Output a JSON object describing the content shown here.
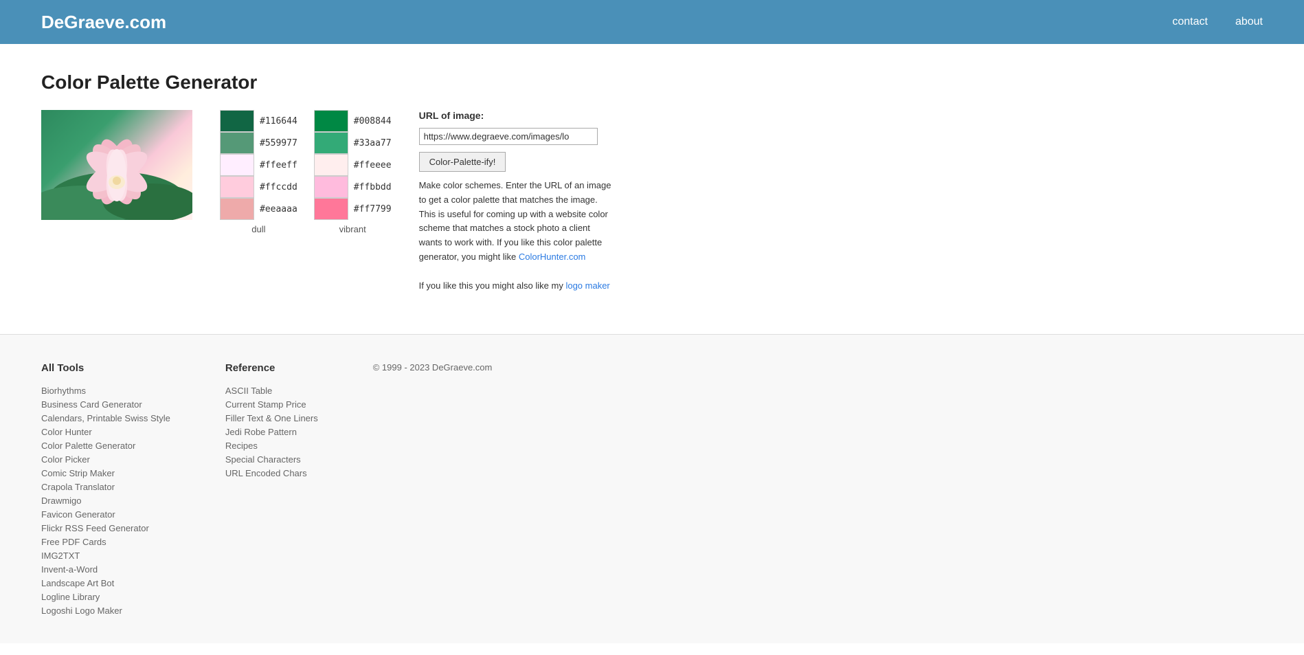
{
  "header": {
    "logo": "DeGraeve.com",
    "nav": [
      {
        "label": "contact",
        "href": "#"
      },
      {
        "label": "about",
        "href": "#"
      }
    ]
  },
  "main": {
    "page_title": "Color Palette Generator",
    "url_label": "URL of image:",
    "url_value": "https://www.degraeve.com/images/lo",
    "generate_button_label": "Color-Palette-ify!",
    "description_text1": "Make color schemes. Enter the URL of an image to get a color palette that matches the image. This is useful for coming up with a website color scheme that matches a stock photo a client wants to work with. If you like this color palette generator, you might like ",
    "colorhunter_link": "ColorHunter.com",
    "description_text2": "If you like this you might also like my ",
    "logomaker_link": "logo maker",
    "dull_label": "dull",
    "vibrant_label": "vibrant",
    "swatches_dull": [
      {
        "hex": "#116644",
        "color": "#116644"
      },
      {
        "hex": "#559977",
        "color": "#559977"
      },
      {
        "hex": "#ffeeff",
        "color": "#ffeeff"
      },
      {
        "hex": "#ffccdd",
        "color": "#ffccdd"
      },
      {
        "hex": "#eeaaaa",
        "color": "#eeaaaa"
      }
    ],
    "swatches_vibrant": [
      {
        "hex": "#008844",
        "color": "#008844"
      },
      {
        "hex": "#33aa77",
        "color": "#33aa77"
      },
      {
        "hex": "#ffeeee",
        "color": "#ffeeee"
      },
      {
        "hex": "#ffbbdd",
        "color": "#ffbbdd"
      },
      {
        "hex": "#ff7799",
        "color": "#ff7799"
      }
    ]
  },
  "footer": {
    "all_tools_label": "All Tools",
    "reference_label": "Reference",
    "copyright": "© 1999 - 2023 DeGraeve.com",
    "all_tools": [
      "Biorhythms",
      "Business Card Generator",
      "Calendars, Printable Swiss Style",
      "Color Hunter",
      "Color Palette Generator",
      "Color Picker",
      "Comic Strip Maker",
      "Crapola Translator",
      "Drawmigo",
      "Favicon Generator",
      "Flickr RSS Feed Generator",
      "Free PDF Cards",
      "IMG2TXT",
      "Invent-a-Word",
      "Landscape Art Bot",
      "Logline Library",
      "Logoshi Logo Maker"
    ],
    "reference": [
      "ASCII Table",
      "Current Stamp Price",
      "Filler Text & One Liners",
      "Jedi Robe Pattern",
      "Recipes",
      "Special Characters",
      "URL Encoded Chars"
    ]
  }
}
